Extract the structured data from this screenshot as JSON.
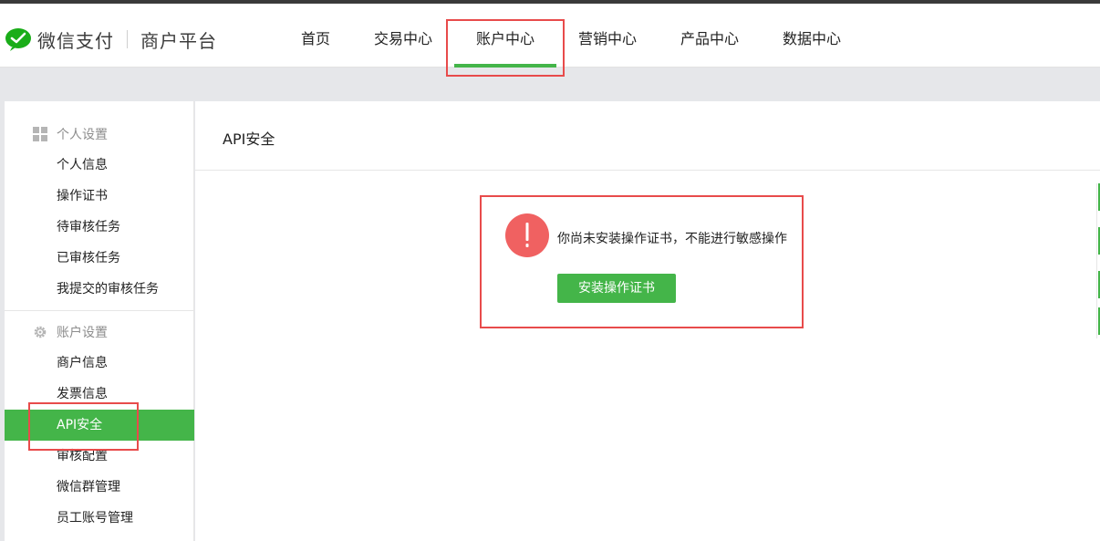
{
  "brand": {
    "name": "微信支付",
    "subtitle": "商户平台",
    "accent_color": "#44b549",
    "logo_icon": "wechat-pay-logo-icon"
  },
  "nav": {
    "items": [
      {
        "label": "首页",
        "active": false
      },
      {
        "label": "交易中心",
        "active": false
      },
      {
        "label": "账户中心",
        "active": true
      },
      {
        "label": "营销中心",
        "active": false
      },
      {
        "label": "产品中心",
        "active": false
      },
      {
        "label": "数据中心",
        "active": false
      }
    ]
  },
  "sidebar": {
    "groups": [
      {
        "title": "个人设置",
        "icon": "grid-icon",
        "items": [
          "个人信息",
          "操作证书",
          "待审核任务",
          "已审核任务",
          "我提交的审核任务"
        ]
      },
      {
        "title": "账户设置",
        "icon": "gear-icon",
        "items": [
          "商户信息",
          "发票信息",
          "API安全",
          "审核配置",
          "微信群管理",
          "员工账号管理"
        ]
      }
    ],
    "active_item": "API安全"
  },
  "main": {
    "title": "API安全",
    "notice": {
      "icon": "exclamation-icon",
      "icon_color": "#f06161",
      "message": "你尚未安装操作证书，不能进行敏感操作",
      "button_label": "安装操作证书"
    }
  },
  "highlight_color": "#e84b4b"
}
